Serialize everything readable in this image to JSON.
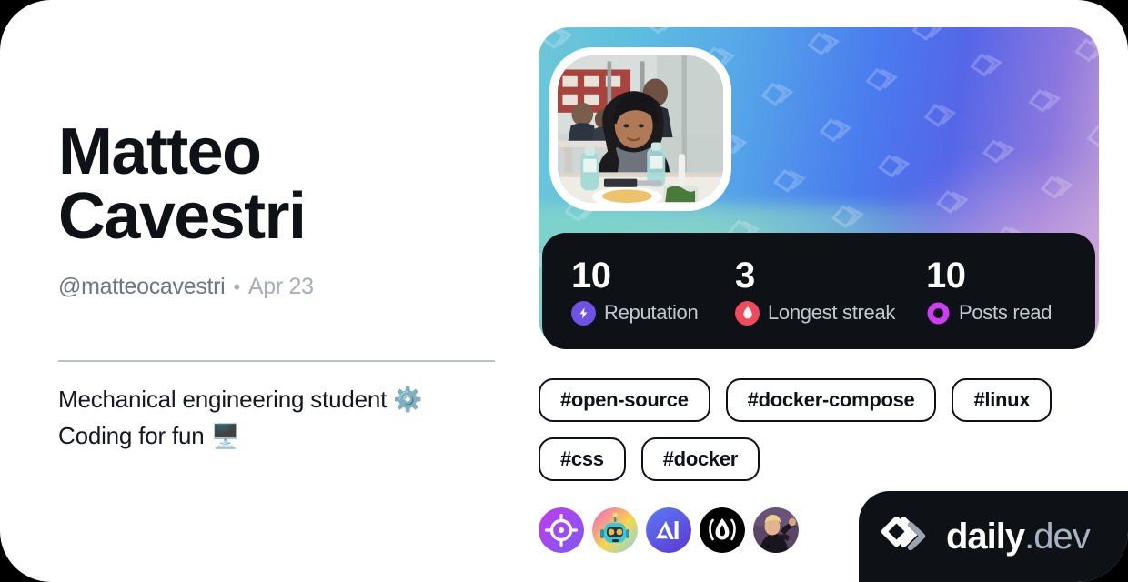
{
  "profile": {
    "name": "Matteo Cavestri",
    "name_line1": "Matteo",
    "name_line2": "Cavestri",
    "handle": "@matteocavestri",
    "separator": "•",
    "joined": "Apr 23",
    "bio": "Mechanical engineering student ⚙️\nCoding for fun 🖥️",
    "avatar_alt": "profile-photo"
  },
  "stats": [
    {
      "value": "10",
      "label": "Reputation",
      "icon": "bolt-icon",
      "color": "#6E52E5"
    },
    {
      "value": "3",
      "label": "Longest streak",
      "icon": "flame-icon",
      "color": "#F2495C"
    },
    {
      "value": "10",
      "label": "Posts read",
      "icon": "ring-icon",
      "color": "#CE3DF3"
    }
  ],
  "tags": [
    {
      "label": "#open-source"
    },
    {
      "label": "#docker-compose"
    },
    {
      "label": "#linux"
    },
    {
      "label": "#css"
    },
    {
      "label": "#docker"
    }
  ],
  "sources": [
    {
      "name": "source-crosshair",
      "icon": "crosshair-icon"
    },
    {
      "name": "source-robot",
      "icon": "robot-icon"
    },
    {
      "name": "source-ai",
      "icon": "ai-triangle-icon"
    },
    {
      "name": "source-flame",
      "icon": "flame-circle-icon"
    },
    {
      "name": "source-person",
      "icon": "person-photo-icon"
    }
  ],
  "branding": {
    "name": "daily",
    "tld": ".dev",
    "logo": "daily-dev-logo"
  },
  "colors": {
    "card_bg": "#FFFFFF",
    "text_primary": "#0E1217",
    "text_muted": "#8B9199",
    "dark_panel": "#0E1217",
    "divider": "#BEC2C8"
  }
}
